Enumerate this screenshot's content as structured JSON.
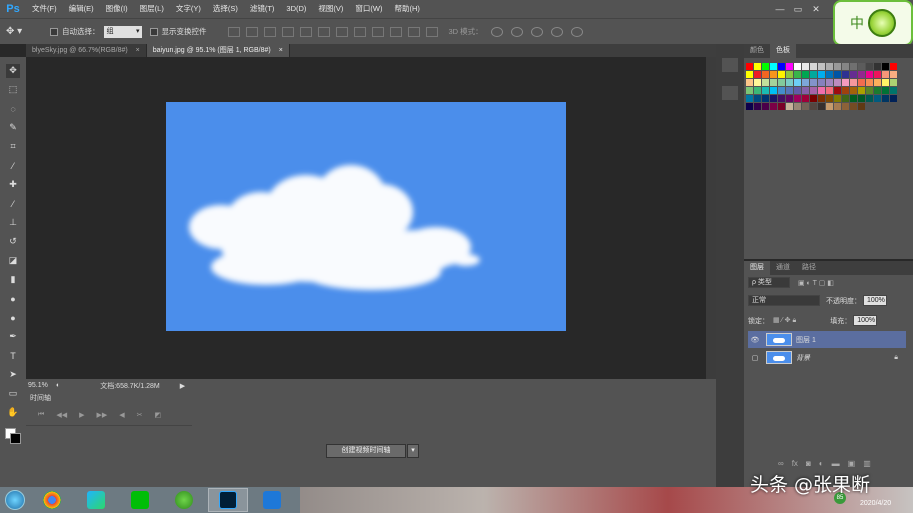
{
  "app": {
    "logo": "Ps"
  },
  "menu": [
    "文件(F)",
    "编辑(E)",
    "图像(I)",
    "图层(L)",
    "文字(Y)",
    "选择(S)",
    "滤镜(T)",
    "3D(D)",
    "视图(V)",
    "窗口(W)",
    "帮助(H)"
  ],
  "window_controls": {
    "minimize": "—",
    "restore": "▭",
    "close": "✕"
  },
  "options": {
    "auto_select_label": "自动选择：",
    "auto_select_value": "组",
    "show_transform_label": "显示变换控件",
    "mode_3d": "3D 模式："
  },
  "corner_logo_char": "中",
  "tabs": [
    {
      "label": "blyeSky.jpg @ 66.7%(RGB/8#)",
      "close": "×"
    },
    {
      "label": "baiyun.jpg @ 95.1% (图层 1, RGB/8#)",
      "close": "×"
    }
  ],
  "status": {
    "zoom": "95.1%",
    "doc": "文档:658.7K/1.28M"
  },
  "timeline": {
    "tab": "时间轴",
    "create_label": "创建视频时间轴",
    "dropdown": "▾"
  },
  "swatches_panel": {
    "tabs": [
      "颜色",
      "色板"
    ]
  },
  "layers_panel": {
    "tabs": [
      "图层",
      "通道",
      "路径"
    ],
    "filter": "ρ 类型",
    "blend_mode": "正常",
    "opacity_label": "不透明度：",
    "opacity_value": "100%",
    "lock_label": "锁定：",
    "fill_label": "填充：",
    "fill_value": "100%",
    "layers": [
      {
        "name": "图层 1",
        "visible": true,
        "selected": true
      },
      {
        "name": "背景",
        "visible": false,
        "locked": true
      }
    ]
  },
  "taskbar": {
    "badge": "85",
    "date": "2020/4/20"
  },
  "watermark": "头条 @张果断",
  "colors": {
    "canvas_blue": "#4b8eeb",
    "panel_gray": "#535353",
    "selected_layer": "#5b6ea0"
  }
}
